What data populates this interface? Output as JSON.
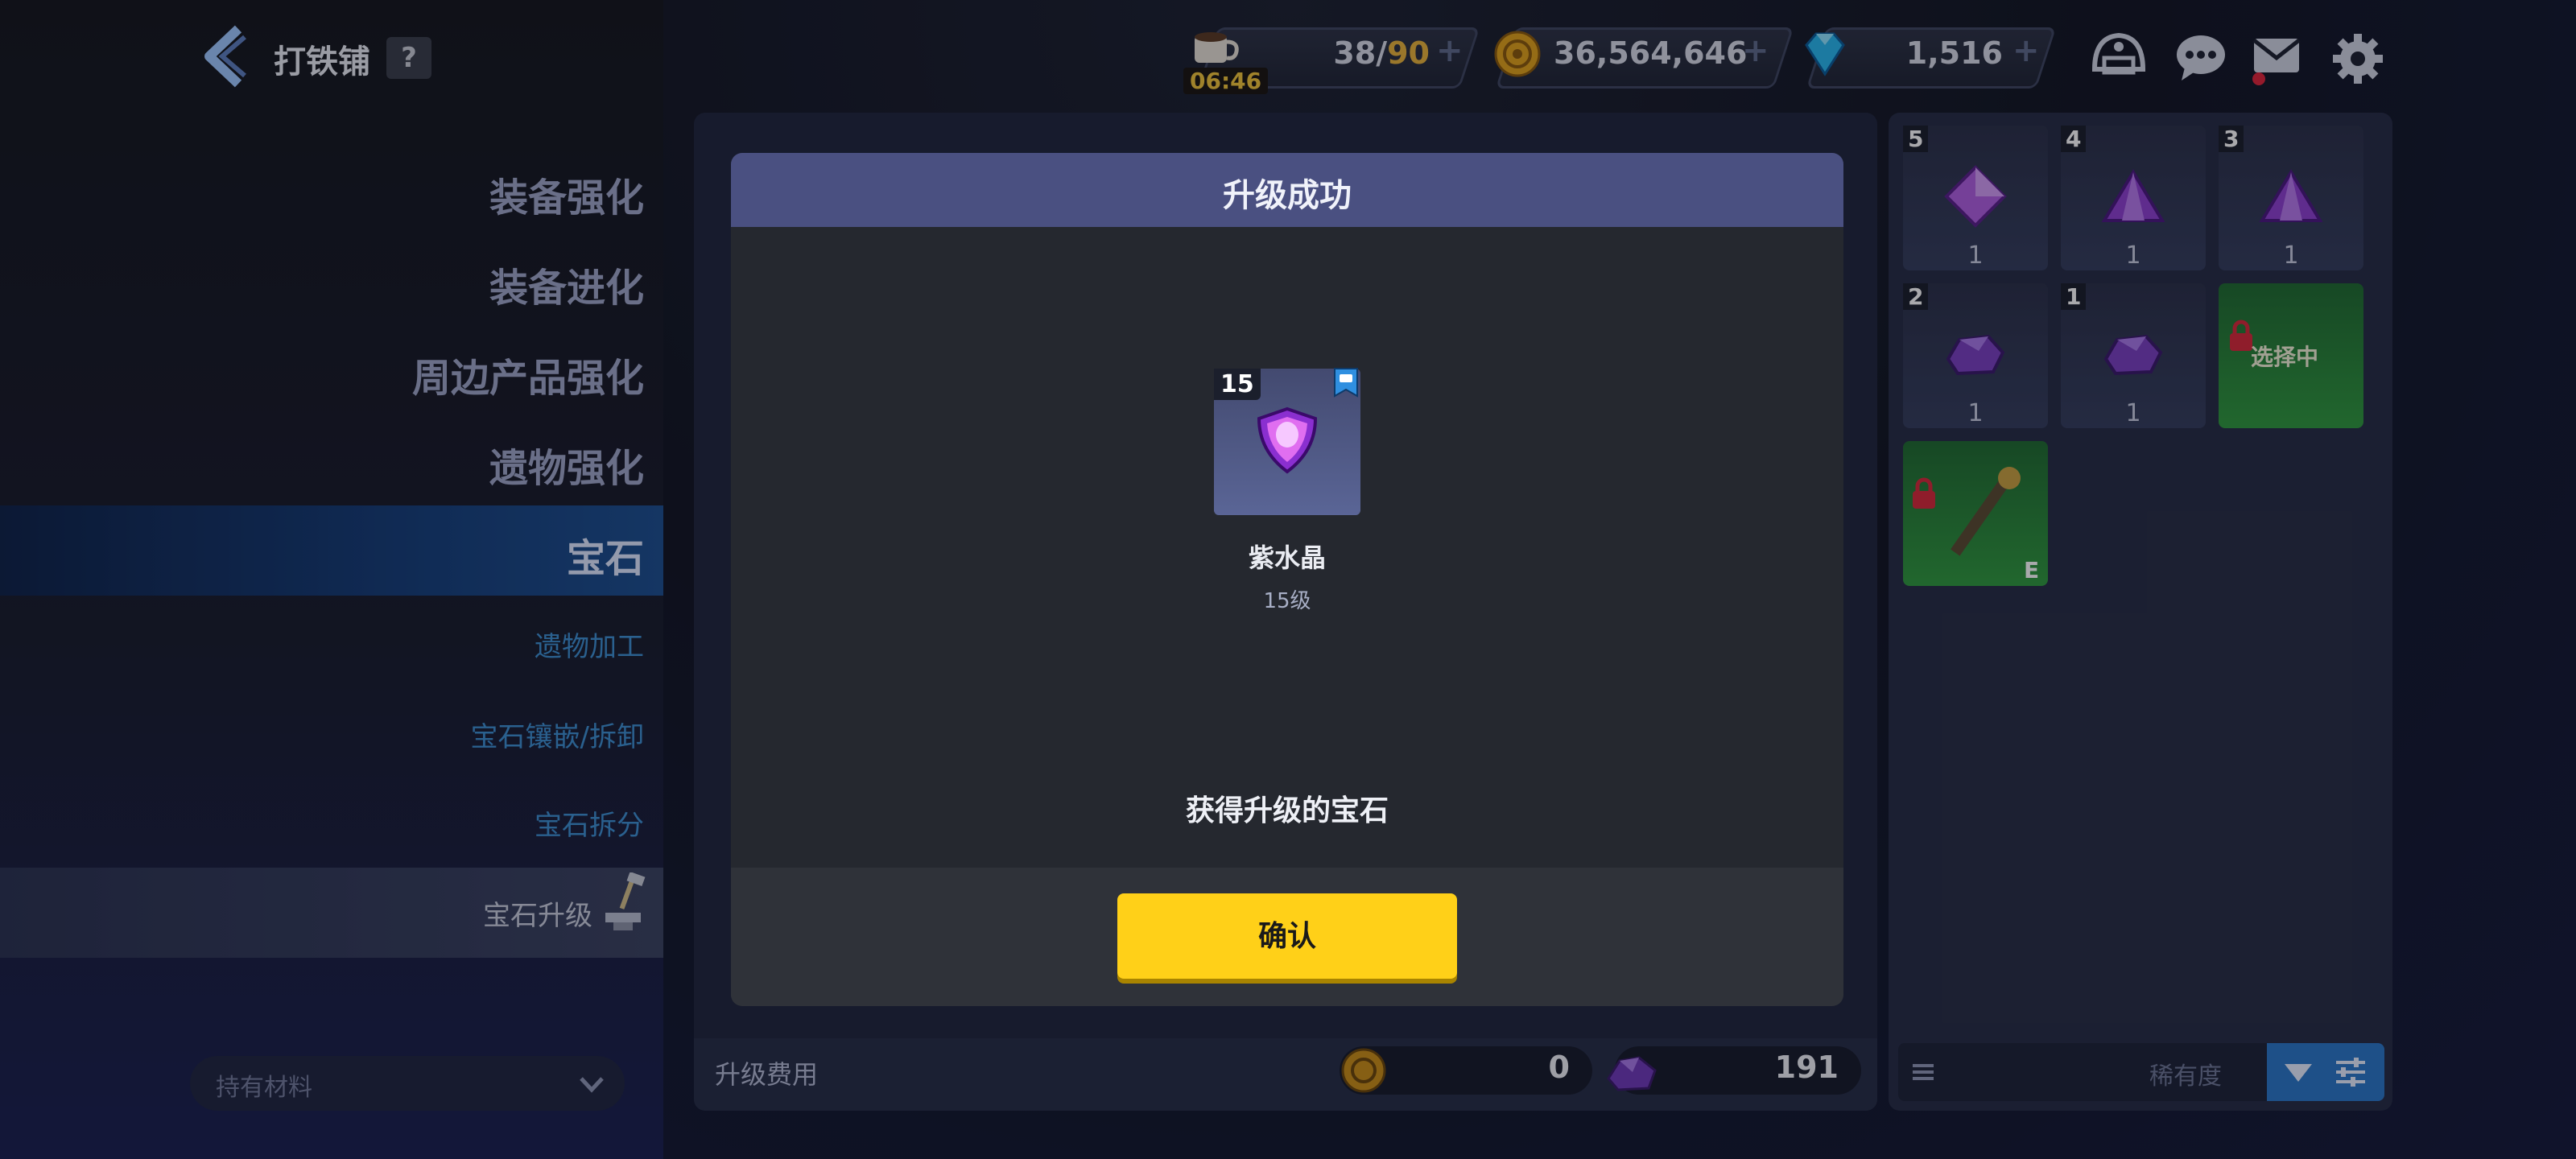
{
  "header": {
    "title": "打铁铺",
    "help": "?"
  },
  "resources": {
    "stamina": {
      "value": "38/90",
      "timer": "06:46"
    },
    "gold": {
      "value": "36,564,646"
    },
    "gems": {
      "value": "1,516"
    }
  },
  "sidebar": {
    "items": [
      {
        "label": "装备强化"
      },
      {
        "label": "装备进化"
      },
      {
        "label": "周边产品强化"
      },
      {
        "label": "遗物强化"
      },
      {
        "label": "宝石"
      }
    ],
    "sub_items": [
      {
        "label": "遗物加工"
      },
      {
        "label": "宝石镶嵌/拆卸"
      },
      {
        "label": "宝石拆分"
      },
      {
        "label": "宝石升级"
      }
    ],
    "materials_dropdown": "持有材料"
  },
  "upgrade_cost": {
    "label": "升级费用",
    "gold": "0",
    "material": "191"
  },
  "inventory": {
    "slots": [
      {
        "level": "5",
        "count": "1",
        "shape": "diamond",
        "color": "#b05fe0"
      },
      {
        "level": "4",
        "count": "1",
        "shape": "triangle",
        "color": "#8e3fd0"
      },
      {
        "level": "3",
        "count": "1",
        "shape": "triangle",
        "color": "#8e3fd0"
      },
      {
        "level": "2",
        "count": "1",
        "shape": "rock",
        "color": "#7a3fc0"
      },
      {
        "level": "1",
        "count": "1",
        "shape": "rock",
        "color": "#7a3fc0"
      },
      {
        "status": "选择中",
        "locked": true
      },
      {
        "grade": "E",
        "locked": true
      }
    ],
    "sort_label": "稀有度"
  },
  "modal": {
    "title": "升级成功",
    "gem_level_badge": "15",
    "gem_name": "紫水晶",
    "gem_level": "15级",
    "message": "获得升级的宝石",
    "confirm": "确认"
  },
  "colors": {
    "accent_yellow": "#ffd018",
    "modal_header": "#4a5081",
    "active_menu": "#143d78",
    "sub_menu_text": "#3d8fd2"
  }
}
